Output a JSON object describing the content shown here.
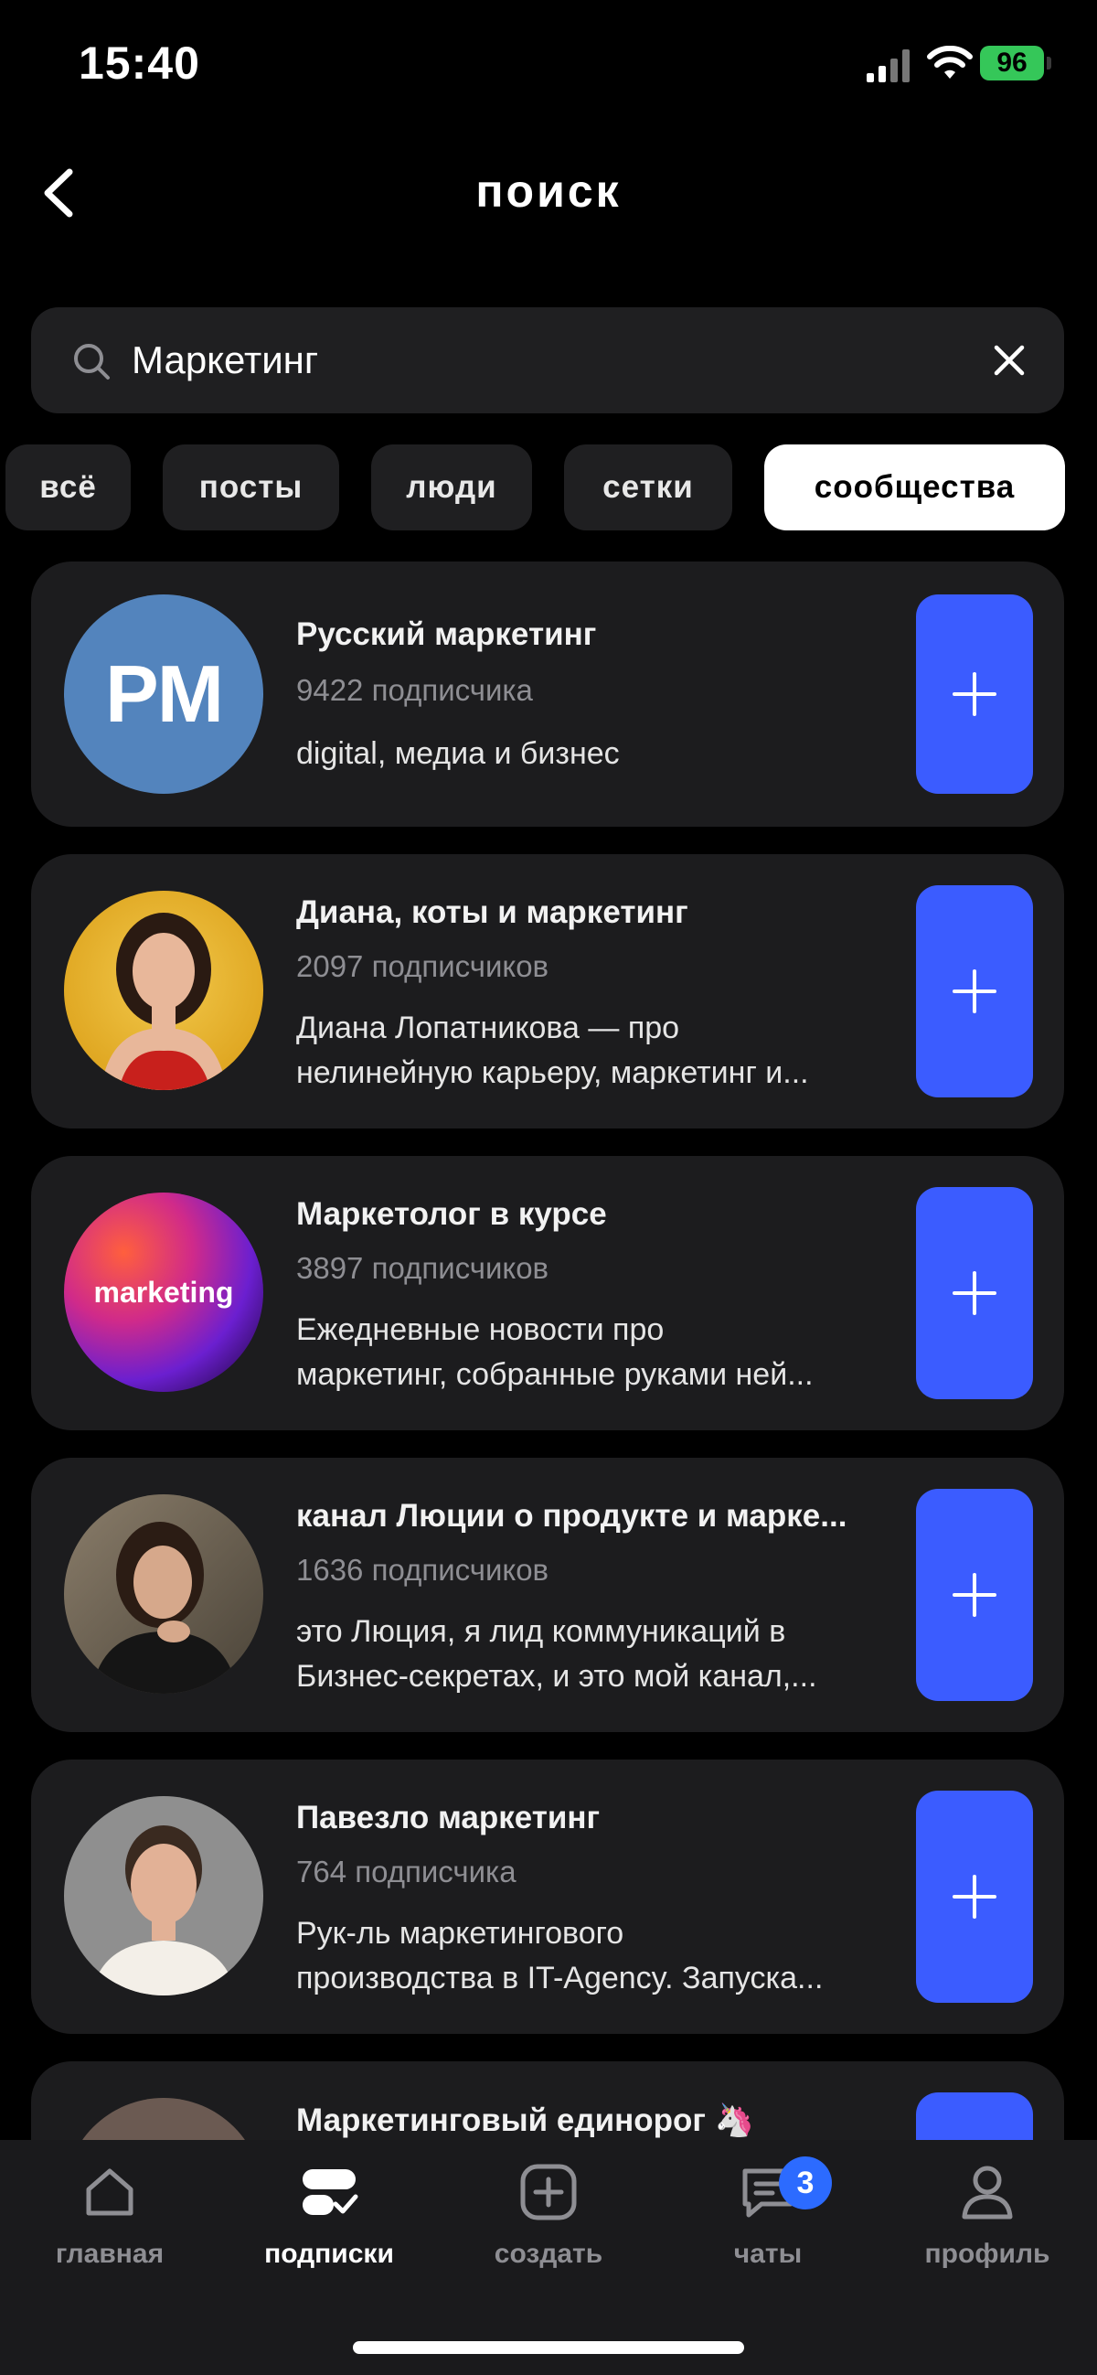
{
  "status_bar": {
    "time": "15:40",
    "battery": "96"
  },
  "header": {
    "title": "поиск"
  },
  "search": {
    "value": "Маркетинг",
    "placeholder": ""
  },
  "filters": [
    {
      "label": "всё",
      "active": false
    },
    {
      "label": "посты",
      "active": false
    },
    {
      "label": "люди",
      "active": false
    },
    {
      "label": "сетки",
      "active": false
    },
    {
      "label": "сообщества",
      "active": true
    }
  ],
  "results": [
    {
      "title": "Русский маркетинг",
      "subscribers": "9422 подписчика",
      "desc": [
        "digital, медиа и бизнес"
      ],
      "avatar_text": "PM"
    },
    {
      "title": "Диана, коты и маркетинг",
      "subscribers": "2097 подписчиков",
      "desc": [
        "Диана Лопатникова — про",
        "нелинейную карьеру, маркетинг и..."
      ]
    },
    {
      "title": "Маркетолог в курсе",
      "subscribers": "3897 подписчиков",
      "desc": [
        "Ежедневные новости про",
        "маркетинг, собранные руками ней..."
      ],
      "avatar_text": "marketing"
    },
    {
      "title": "канал Люции о продукте и марке...",
      "subscribers": "1636 подписчиков",
      "desc": [
        "это Люция, я лид коммуникаций в",
        "Бизнес-секретах, и это мой канал,..."
      ]
    },
    {
      "title": "Павезло маркетинг",
      "subscribers": "764 подписчика",
      "desc": [
        "Рук-ль маркетингового",
        "производства в IT-Agency. Запуска..."
      ]
    },
    {
      "title": "Маркетинговый единорог 🦄"
    }
  ],
  "tabbar": {
    "items": [
      {
        "label": "главная",
        "icon": "home-icon"
      },
      {
        "label": "подписки",
        "icon": "subscriptions-icon",
        "active": true
      },
      {
        "label": "создать",
        "icon": "create-icon"
      },
      {
        "label": "чаты",
        "icon": "chat-icon",
        "badge": "3"
      },
      {
        "label": "профиль",
        "icon": "profile-icon"
      }
    ]
  },
  "colors": {
    "accent": "#3b5cff",
    "background": "#000000",
    "card": "#1c1c1e",
    "badge": "#2c6bff"
  }
}
